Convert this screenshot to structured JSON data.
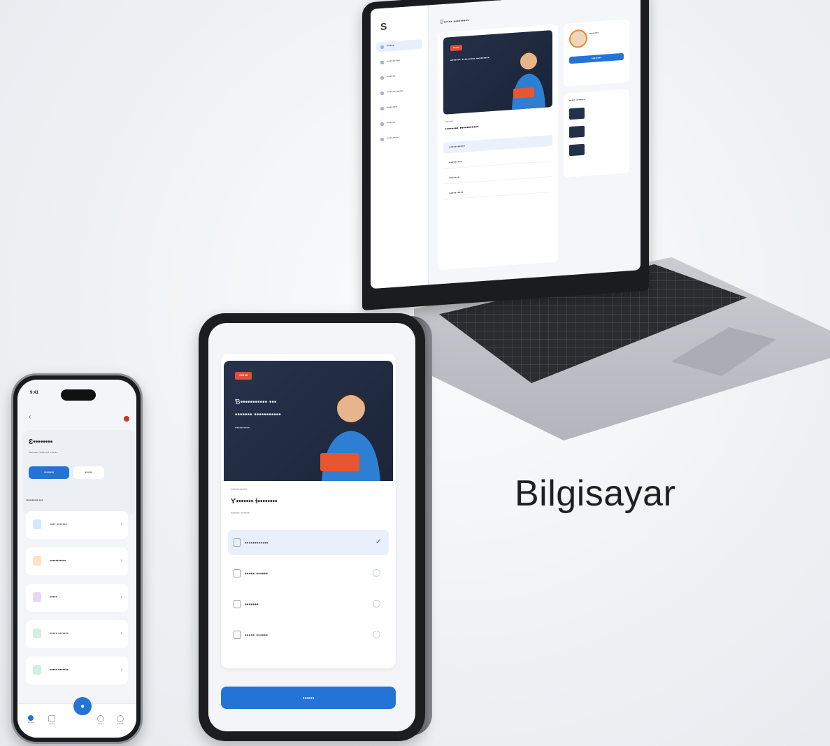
{
  "caption": "Bilgisayar",
  "laptop": {
    "logo": "S",
    "nav": [
      "•••••",
      "•••••••••",
      "••••••",
      "•••••••••••",
      "•••••••",
      "••••••",
      "••••••••"
    ],
    "title": "Ⴒ••••• •••••••••",
    "video_tag": "•••••",
    "video_text": "••••••• ••••••••• •••••••••",
    "lesson_title": "•••••••• •••••••••••",
    "rows": [
      "•••••••••••",
      "•••••••••",
      "•••••••",
      "••••• ••••"
    ],
    "profile": "••••••••",
    "profile_button": "••••••••",
    "list_title": "••••• •••••••"
  },
  "tablet": {
    "video_tag": "•••••",
    "video_line1": "Ɓ••••••••••• •••",
    "video_line2": "••••••• •••••••••••",
    "video_line3": "••••••••••",
    "small_label": "•••••••••••",
    "heading": "Ƴ••••••• ɬ••••••••",
    "subheading": "•••••• ••••••",
    "options": [
      "••••••••••••",
      "••••• ••••••",
      "•••••••",
      "••••• ••••••"
    ],
    "button": "••••••"
  },
  "phone": {
    "status_time": "9:41",
    "title": "Ɛ••••••••",
    "subtitle": "•••••••• •••••••• ••••••",
    "primary_btn": "••••••••",
    "secondary_btn": "••••••",
    "section": "•••••••••• •••",
    "items": [
      "•••• •••••••",
      "•••••••••••",
      "•••••",
      "••••• •••••••",
      "••••• •••••••"
    ],
    "nav": [
      "•••••",
      "•••••",
      "•••••",
      "•••••"
    ]
  },
  "colors": {
    "accent": "#2473d6",
    "tag": "#e44d3a",
    "video_bg": "#25314a"
  }
}
